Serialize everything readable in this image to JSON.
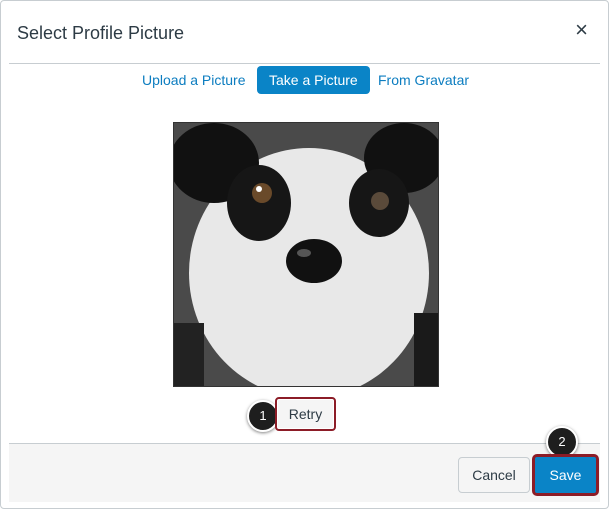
{
  "dialog": {
    "title": "Select Profile Picture",
    "close_label": "×"
  },
  "tabs": [
    {
      "label": "Upload a Picture",
      "active": false
    },
    {
      "label": "Take a Picture",
      "active": true
    },
    {
      "label": "From Gravatar",
      "active": false
    }
  ],
  "photo": {
    "icon": "webcam-photo-image"
  },
  "actions": {
    "retry_label": "Retry",
    "cancel_label": "Cancel",
    "save_label": "Save"
  },
  "callouts": [
    "1",
    "2"
  ],
  "colors": {
    "accent": "#0a84c7",
    "highlight_border": "#8c1c27",
    "text": "#2d3b45"
  }
}
